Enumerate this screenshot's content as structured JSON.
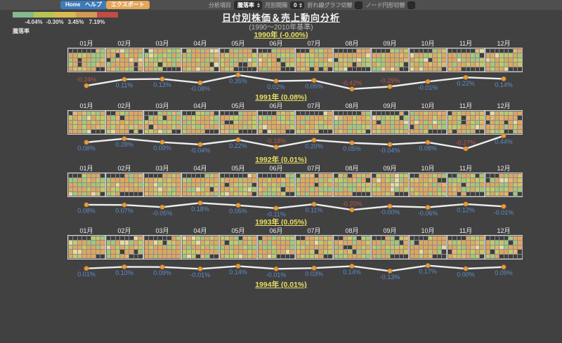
{
  "toolbar": {
    "home": "Home",
    "help": "ヘルプ",
    "export": "エクスポート"
  },
  "controls": {
    "analysis_label": "分析項目",
    "analysis_value": "騰落率",
    "interval_label": "月別間隔",
    "interval_value": "0",
    "line_toggle_label": "折れ線グラフ切替",
    "node_toggle_label": "ノード円形切替"
  },
  "legend": {
    "title": "騰落率",
    "colors": [
      "#84b98e",
      "#b8c353",
      "#d6bc52",
      "#d29a55",
      "#bf4c49"
    ],
    "thresholds": [
      "-4.04%",
      "-0.30%",
      "3.45%",
      "7.19%"
    ]
  },
  "header": {
    "title": "日付別株価＆売上動向分析",
    "subtitle": "(1990〜2010年基準)"
  },
  "month_labels": [
    "01月",
    "02月",
    "03月",
    "04月",
    "05月",
    "06月",
    "07月",
    "08月",
    "09月",
    "10月",
    "11月",
    "12月"
  ],
  "chart_data": [
    {
      "type": "line",
      "title": "1990年 (-0.00%)",
      "categories": [
        "01月",
        "02月",
        "03月",
        "04月",
        "05月",
        "06月",
        "07月",
        "08月",
        "09月",
        "10月",
        "11月",
        "12月"
      ],
      "values": [
        -0.24,
        0.11,
        0.13,
        -0.08,
        0.35,
        0.02,
        0.05,
        -0.42,
        -0.29,
        -0.01,
        0.22,
        0.14
      ],
      "point_labels": [
        "-0.24%",
        "0.11%",
        "0.13%",
        "-0.08%",
        "0.35%",
        "0.02%",
        "0.05%",
        "-0.42%",
        "-0.29%",
        "-0.01%",
        "0.22%",
        "0.14%"
      ]
    },
    {
      "type": "line",
      "title": "1991年 (0.08%)",
      "categories": [
        "01月",
        "02月",
        "03月",
        "04月",
        "05月",
        "06月",
        "07月",
        "08月",
        "09月",
        "10月",
        "11月",
        "12月"
      ],
      "values": [
        0.08,
        0.28,
        0.09,
        -0.04,
        0.22,
        -0.18,
        0.2,
        0.05,
        -0.04,
        0.08,
        -0.27,
        0.44
      ],
      "point_labels": [
        "0.08%",
        "0.28%",
        "0.09%",
        "-0.04%",
        "0.22%",
        "-0.18%",
        "0.20%",
        "0.05%",
        "-0.04%",
        "0.08%",
        "-0.27%",
        "0.44%"
      ]
    },
    {
      "type": "line",
      "title": "1992年 (0.01%)",
      "categories": [
        "01月",
        "02月",
        "03月",
        "04月",
        "05月",
        "06月",
        "07月",
        "08月",
        "09月",
        "10月",
        "11月",
        "12月"
      ],
      "values": [
        0.08,
        0.07,
        -0.05,
        0.18,
        0.05,
        -0.11,
        0.11,
        -0.2,
        -0.0,
        -0.06,
        0.12,
        -0.01
      ],
      "point_labels": [
        "0.08%",
        "0.07%",
        "-0.05%",
        "0.18%",
        "0.05%",
        "-0.11%",
        "0.11%",
        "-0.20%",
        "-0.00%",
        "-0.06%",
        "0.12%",
        "-0.01%"
      ]
    },
    {
      "type": "line",
      "title": "1993年 (0.05%)",
      "categories": [
        "01月",
        "02月",
        "03月",
        "04月",
        "05月",
        "06月",
        "07月",
        "08月",
        "09月",
        "10月",
        "11月",
        "12月"
      ],
      "values": [
        0.01,
        0.1,
        0.09,
        -0.01,
        0.14,
        -0.01,
        0.03,
        0.14,
        -0.13,
        0.17,
        0.0,
        0.09
      ],
      "point_labels": [
        "0.01%",
        "0.10%",
        "0.09%",
        "-0.01%",
        "0.14%",
        "-0.01%",
        "0.03%",
        "0.14%",
        "-0.13%",
        "0.17%",
        "0.00%",
        "0.09%"
      ]
    }
  ],
  "years": [
    {
      "heading": "1990年 (-0.00%)",
      "chart_index": 0
    },
    {
      "heading": "1991年 (0.08%)",
      "chart_index": 1
    },
    {
      "heading": "1992年 (0.01%)",
      "chart_index": 2
    },
    {
      "heading": "1993年 (0.05%)",
      "chart_index": 3
    },
    {
      "heading": "1994年 (0.01%)",
      "chart_index": -1
    }
  ],
  "heatmap": {
    "columns": 8,
    "rows": 5,
    "palette": [
      "#dfa75e",
      "#c2ca68",
      "#a1c87a",
      "#e5b76e",
      "#e9d9a5"
    ],
    "empty_color": "#3f3f3f",
    "seed": 7
  },
  "line_style": {
    "line_color": "#ededed",
    "node_color": "#e79b3d",
    "node_stroke": "#a86f24",
    "label_blue": "#5d8cc9",
    "label_red": "#c0544b",
    "red_threshold": -0.15
  }
}
